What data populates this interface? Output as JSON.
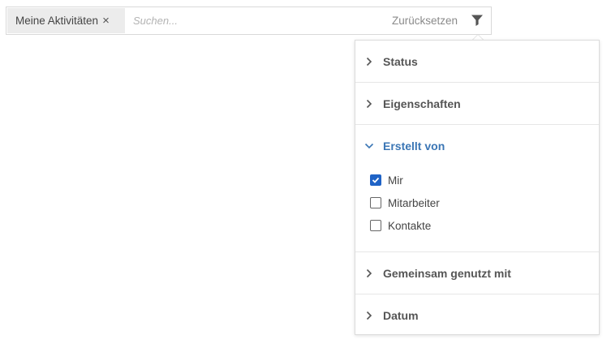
{
  "search": {
    "chip_label": "Meine Aktivitäten",
    "chip_remove": "×",
    "placeholder": "Suchen...",
    "reset_label": "Zurücksetzen"
  },
  "filter_panel": {
    "sections": [
      {
        "label": "Status",
        "expanded": false
      },
      {
        "label": "Eigenschaften",
        "expanded": false
      },
      {
        "label": "Erstellt von",
        "expanded": true,
        "options": [
          {
            "label": "Mir",
            "checked": true
          },
          {
            "label": "Mitarbeiter",
            "checked": false
          },
          {
            "label": "Kontakte",
            "checked": false
          }
        ]
      },
      {
        "label": "Gemeinsam genutzt mit",
        "expanded": false
      },
      {
        "label": "Datum",
        "expanded": false
      }
    ]
  },
  "colors": {
    "accent": "#3b76b5",
    "checkbox_checked": "#1f63c6",
    "chip_bg": "#ececec"
  },
  "icons": {
    "filter": "funnel-icon",
    "collapsed": "chevron-right-icon",
    "expanded": "chevron-down-icon"
  }
}
